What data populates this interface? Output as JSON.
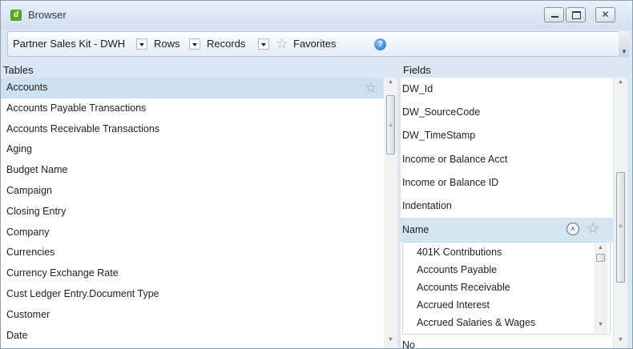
{
  "window": {
    "title": "Browser",
    "app_icon_glyph": "d",
    "close_glyph": "✕"
  },
  "toolbar": {
    "model": "Partner Sales Kit - DWH",
    "rows_label": "Rows",
    "records_label": "Records",
    "favorites_label": "Favorites",
    "star_glyph": "☆",
    "help_glyph": "?"
  },
  "tables": {
    "header": "Tables",
    "selected_index": 0,
    "items": [
      {
        "label": "Accounts"
      },
      {
        "label": "Accounts Payable Transactions"
      },
      {
        "label": "Accounts Receivable Transactions"
      },
      {
        "label": "Aging"
      },
      {
        "label": "Budget Name"
      },
      {
        "label": "Campaign"
      },
      {
        "label": "Closing Entry"
      },
      {
        "label": "Company"
      },
      {
        "label": "Currencies"
      },
      {
        "label": "Currency Exchange Rate"
      },
      {
        "label": "Cust Ledger Entry.Document Type"
      },
      {
        "label": "Customer"
      },
      {
        "label": "Date"
      }
    ],
    "star_glyph": "☆"
  },
  "fields": {
    "header": "Fields",
    "items": [
      {
        "label": "DW_Id"
      },
      {
        "label": "DW_SourceCode"
      },
      {
        "label": "DW_TimeStamp"
      },
      {
        "label": "Income or Balance Acct"
      },
      {
        "label": "Income or Balance ID"
      },
      {
        "label": "Indentation"
      }
    ],
    "expanded": {
      "label": "Name",
      "collapse_glyph": "˄",
      "star_glyph": "☆",
      "values": [
        "401K Contributions",
        "Accounts Payable",
        "Accounts Receivable",
        "Accrued Interest",
        "Accrued Salaries & Wages"
      ]
    },
    "partial_next": "No"
  },
  "scrollbar": {
    "up_glyph": "▲",
    "down_glyph": "▼",
    "grip_glyph": "≡"
  },
  "colors": {
    "selection": "#cfe0ef",
    "window_bg": "#dbe6f3"
  }
}
